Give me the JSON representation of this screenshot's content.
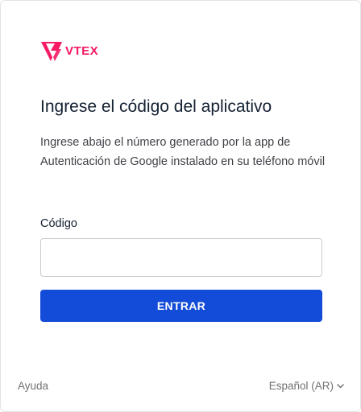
{
  "brand": {
    "name": "VTEX",
    "color": "#f71963"
  },
  "main": {
    "title": "Ingrese el código del aplicativo",
    "description": "Ingrese abajo el número generado por la app de Autenticación de Google instalado en su teléfono móvil"
  },
  "form": {
    "code_label": "Código",
    "code_value": "",
    "code_placeholder": "",
    "submit_label": "ENTRAR",
    "submit_color": "#134cd8"
  },
  "footer": {
    "help_label": "Ayuda",
    "language_label": "Español (AR)",
    "language_icon": "chevron-down-icon"
  }
}
